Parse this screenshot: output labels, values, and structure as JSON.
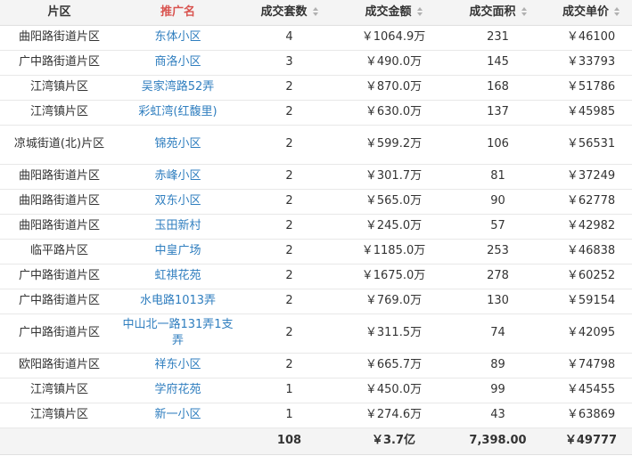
{
  "table": {
    "headers": [
      "片区",
      "推广名",
      "成交套数",
      "成交金额",
      "成交面积",
      "成交单价"
    ],
    "rows": [
      {
        "area": "曲阳路街道片区",
        "name": "东体小区",
        "count": "4",
        "amount": "￥1064.9万",
        "size": "231",
        "price": "￥46100"
      },
      {
        "area": "广中路街道片区",
        "name": "商洛小区",
        "count": "3",
        "amount": "￥490.0万",
        "size": "145",
        "price": "￥33793"
      },
      {
        "area": "江湾镇片区",
        "name": "吴家湾路52弄",
        "count": "2",
        "amount": "￥870.0万",
        "size": "168",
        "price": "￥51786"
      },
      {
        "area": "江湾镇片区",
        "name": "彩虹湾(红馥里)",
        "count": "2",
        "amount": "￥630.0万",
        "size": "137",
        "price": "￥45985"
      },
      {
        "area": "凉城街道(北)片区",
        "name": "锦苑小区",
        "count": "2",
        "amount": "￥599.2万",
        "size": "106",
        "price": "￥56531"
      },
      {
        "area": "曲阳路街道片区",
        "name": "赤峰小区",
        "count": "2",
        "amount": "￥301.7万",
        "size": "81",
        "price": "￥37249"
      },
      {
        "area": "曲阳路街道片区",
        "name": "双东小区",
        "count": "2",
        "amount": "￥565.0万",
        "size": "90",
        "price": "￥62778"
      },
      {
        "area": "曲阳路街道片区",
        "name": "玉田新村",
        "count": "2",
        "amount": "￥245.0万",
        "size": "57",
        "price": "￥42982"
      },
      {
        "area": "临平路片区",
        "name": "中皇广场",
        "count": "2",
        "amount": "￥1185.0万",
        "size": "253",
        "price": "￥46838"
      },
      {
        "area": "广中路街道片区",
        "name": "虹祺花苑",
        "count": "2",
        "amount": "￥1675.0万",
        "size": "278",
        "price": "￥60252"
      },
      {
        "area": "广中路街道片区",
        "name": "水电路1013弄",
        "count": "2",
        "amount": "￥769.0万",
        "size": "130",
        "price": "￥59154"
      },
      {
        "area": "广中路街道片区",
        "name": "中山北一路131弄1支弄",
        "count": "2",
        "amount": "￥311.5万",
        "size": "74",
        "price": "￥42095"
      },
      {
        "area": "欧阳路街道片区",
        "name": "祥东小区",
        "count": "2",
        "amount": "￥665.7万",
        "size": "89",
        "price": "￥74798"
      },
      {
        "area": "江湾镇片区",
        "name": "学府花苑",
        "count": "1",
        "amount": "￥450.0万",
        "size": "99",
        "price": "￥45455"
      },
      {
        "area": "江湾镇片区",
        "name": "新一小区",
        "count": "1",
        "amount": "￥274.6万",
        "size": "43",
        "price": "￥63869"
      }
    ],
    "footer": {
      "count": "108",
      "amount": "￥3.7亿",
      "size": "7,398.00",
      "price": "￥49777"
    }
  },
  "colors": {
    "link": "#2f7ebf",
    "active_header": "#d9534f",
    "header_bg": "#f4f4f4"
  }
}
